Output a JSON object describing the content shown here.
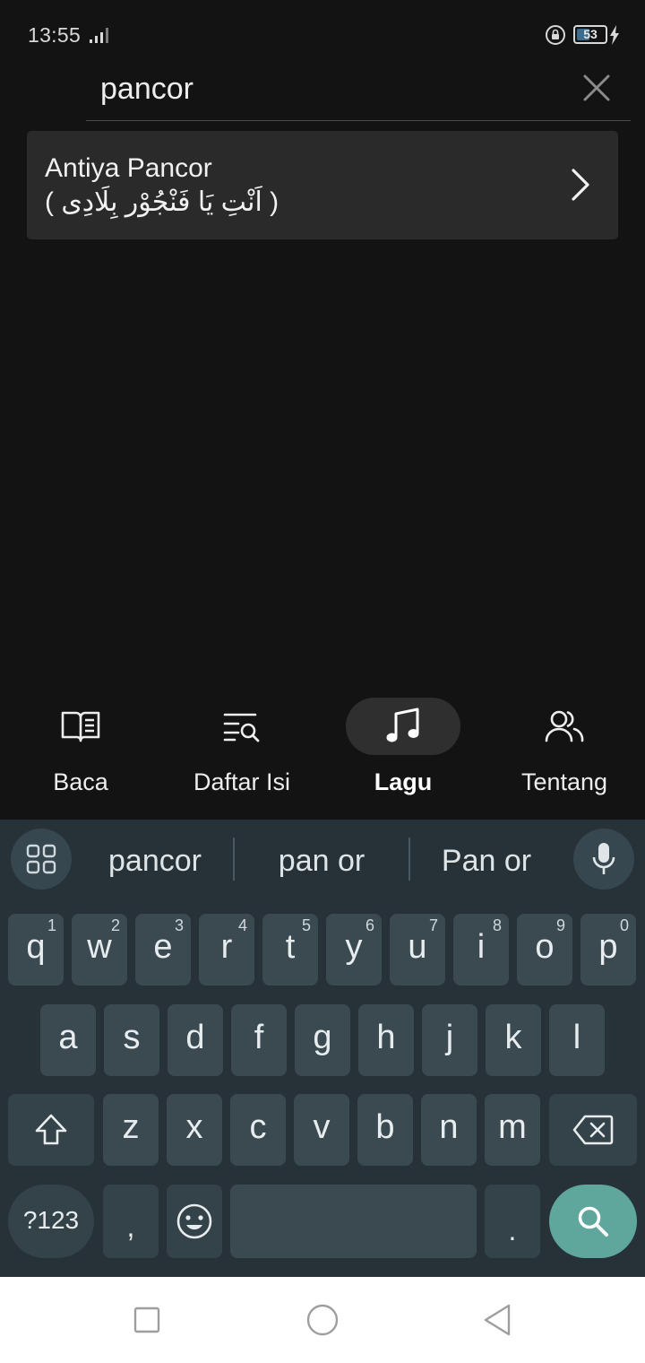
{
  "status_bar": {
    "time": "13:55",
    "battery_level": "53",
    "battery_fraction": 0.53
  },
  "search": {
    "value": "pancor"
  },
  "results": [
    {
      "title": "Antiya Pancor",
      "subtitle": "( اَنْتِ يَا فَنْجُوْر بِلَادِى )"
    }
  ],
  "nav": {
    "items": [
      {
        "label": "Baca",
        "icon": "book-icon"
      },
      {
        "label": "Daftar Isi",
        "icon": "list-search-icon"
      },
      {
        "label": "Lagu",
        "icon": "music-note-icon",
        "active": true
      },
      {
        "label": "Tentang",
        "icon": "people-icon"
      }
    ]
  },
  "keyboard": {
    "suggestions": [
      "pancor",
      "pan or",
      "Pan or"
    ],
    "row1": [
      {
        "char": "q",
        "hint": "1"
      },
      {
        "char": "w",
        "hint": "2"
      },
      {
        "char": "e",
        "hint": "3"
      },
      {
        "char": "r",
        "hint": "4"
      },
      {
        "char": "t",
        "hint": "5"
      },
      {
        "char": "y",
        "hint": "6"
      },
      {
        "char": "u",
        "hint": "7"
      },
      {
        "char": "i",
        "hint": "8"
      },
      {
        "char": "o",
        "hint": "9"
      },
      {
        "char": "p",
        "hint": "0"
      }
    ],
    "row2": [
      "a",
      "s",
      "d",
      "f",
      "g",
      "h",
      "j",
      "k",
      "l"
    ],
    "row3": [
      "z",
      "x",
      "c",
      "v",
      "b",
      "n",
      "m"
    ],
    "symbols_label": "?123",
    "comma": ",",
    "period": ".",
    "accent_color": "#5fa69d"
  }
}
